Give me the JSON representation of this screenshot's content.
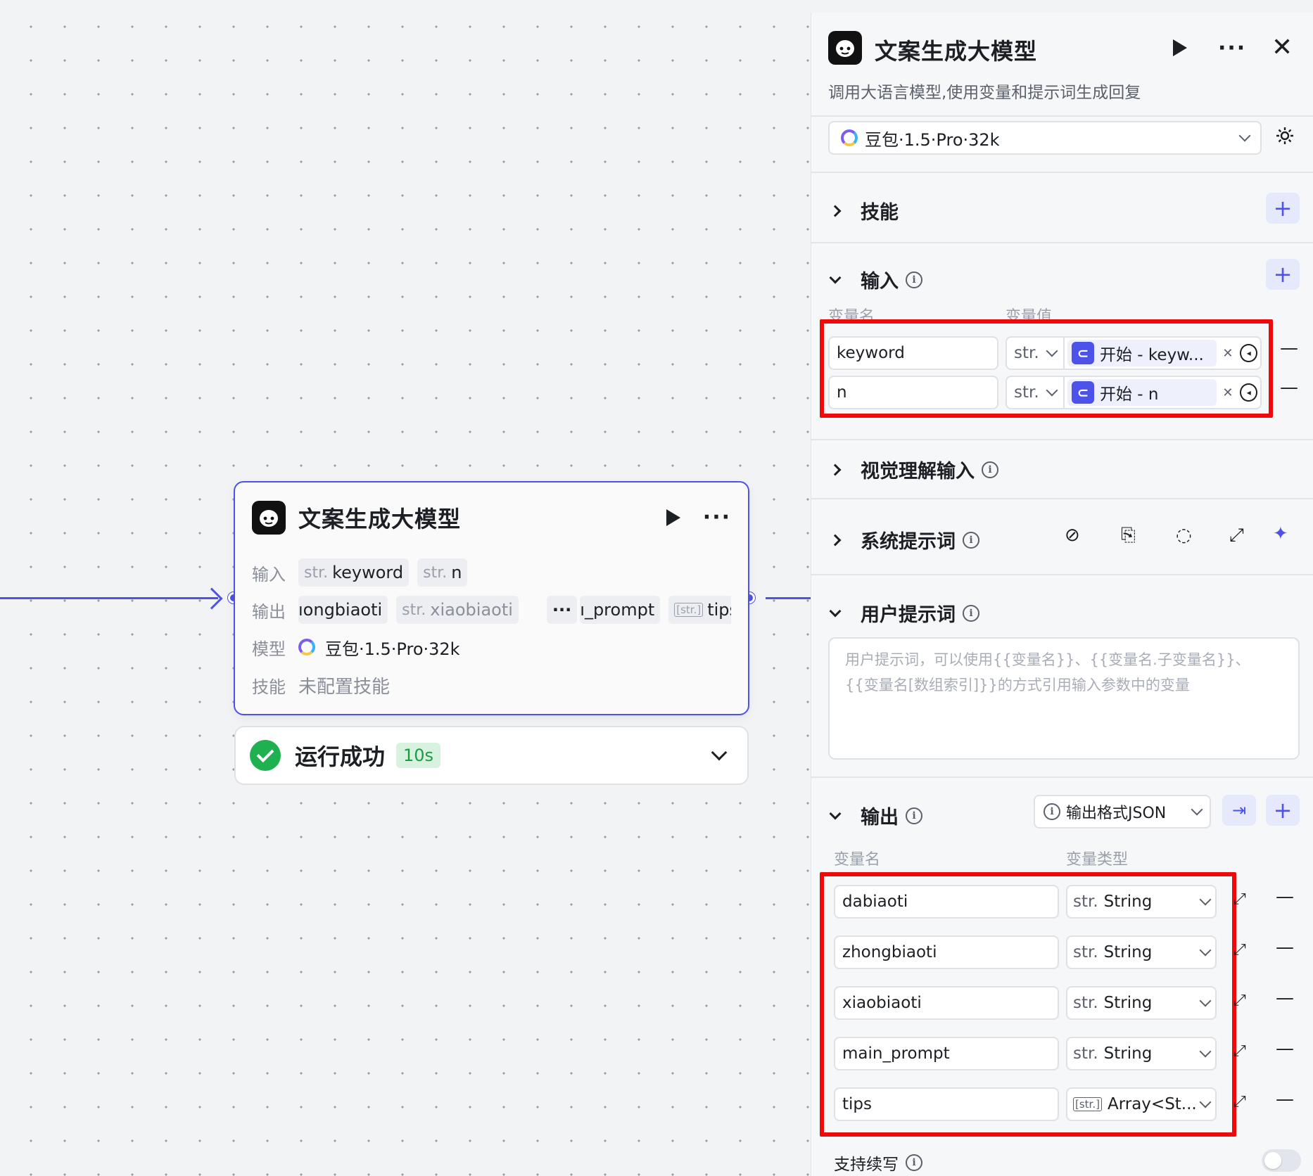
{
  "canvas": {
    "node": {
      "title": "文案生成大模型",
      "input_label": "输入",
      "inputs": [
        {
          "type": "str.",
          "name": "keyword"
        },
        {
          "type": "str.",
          "name": "n"
        }
      ],
      "output_label": "输出",
      "outputs": [
        {
          "type": "",
          "name": "ıongbiaoti"
        },
        {
          "type": "str.",
          "name": "xiaobiaoti"
        },
        {
          "type": "",
          "name": "ı_prompt"
        },
        {
          "type": "[str.]",
          "name": "tips"
        }
      ],
      "more_label": "···",
      "model_label": "模型",
      "model_name": "豆包·1.5·Pro·32k",
      "skill_label": "技能",
      "skill_value": "未配置技能"
    },
    "status": {
      "text": "运行成功",
      "duration": "10s"
    }
  },
  "panel": {
    "title": "文案生成大模型",
    "description": "调用大语言模型,使用变量和提示词生成回复",
    "model": "豆包·1.5·Pro·32k",
    "skills": {
      "title": "技能"
    },
    "input": {
      "title": "输入",
      "col_name": "变量名",
      "col_value": "变量值",
      "rows": [
        {
          "name": "keyword",
          "type": "str.",
          "ref": "开始 - keyw..."
        },
        {
          "name": "n",
          "type": "str.",
          "ref": "开始 - n"
        }
      ]
    },
    "vision": {
      "title": "视觉理解输入"
    },
    "system_prompt": {
      "title": "系统提示词"
    },
    "user_prompt": {
      "title": "用户提示词",
      "placeholder": "用户提示词，可以使用{{变量名}}、{{变量名.子变量名}}、{{变量名[数组索引]}}的方式引用输入参数中的变量"
    },
    "output": {
      "title": "输出",
      "format": "输出格式JSON",
      "col_name": "变量名",
      "col_type": "变量类型",
      "rows": [
        {
          "name": "dabiaoti",
          "type_icon": "str.",
          "type": "String"
        },
        {
          "name": "zhongbiaoti",
          "type_icon": "str.",
          "type": "String"
        },
        {
          "name": "xiaobiaoti",
          "type_icon": "str.",
          "type": "String"
        },
        {
          "name": "main_prompt",
          "type_icon": "str.",
          "type": "String"
        },
        {
          "name": "tips",
          "type_icon": "[str.]",
          "type": "Array<St..."
        }
      ]
    },
    "continue": {
      "label": "支持续写",
      "enabled": false
    }
  },
  "colors": {
    "accent": "#4d53e8",
    "success": "#1fb14f",
    "highlight": "#ee0a0a"
  }
}
